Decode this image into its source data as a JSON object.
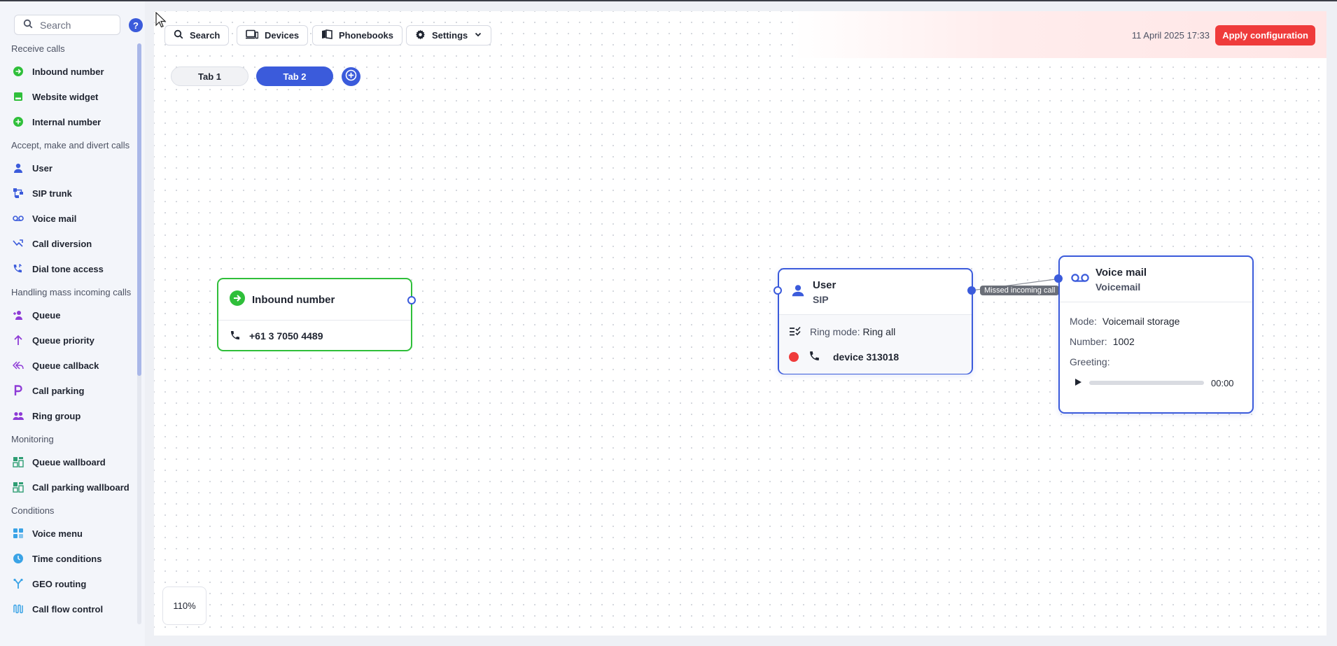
{
  "sidebar": {
    "search_placeholder": "Search",
    "help_label": "?",
    "sections": [
      {
        "title": "Receive calls",
        "items": [
          {
            "label": "Inbound number",
            "icon": "arrow-right-circle-icon",
            "color": "#2fbf3a"
          },
          {
            "label": "Website widget",
            "icon": "widget-icon",
            "color": "#2fbf3a"
          },
          {
            "label": "Internal number",
            "icon": "plus-circle-icon",
            "color": "#2fbf3a"
          }
        ]
      },
      {
        "title": "Accept, make and divert calls",
        "items": [
          {
            "label": "User",
            "icon": "user-icon",
            "color": "#3b5bdb"
          },
          {
            "label": "SIP trunk",
            "icon": "sip-trunk-icon",
            "color": "#3b5bdb"
          },
          {
            "label": "Voice mail",
            "icon": "voicemail-icon",
            "color": "#3b5bdb"
          },
          {
            "label": "Call diversion",
            "icon": "call-diversion-icon",
            "color": "#3b5bdb"
          },
          {
            "label": "Dial tone access",
            "icon": "phone-dial-icon",
            "color": "#3b5bdb"
          }
        ]
      },
      {
        "title": "Handling mass incoming calls",
        "items": [
          {
            "label": "Queue",
            "icon": "queue-icon",
            "color": "#8e3bd6"
          },
          {
            "label": "Queue priority",
            "icon": "arrow-up-icon",
            "color": "#8e3bd6"
          },
          {
            "label": "Queue callback",
            "icon": "reply-all-icon",
            "color": "#8e3bd6"
          },
          {
            "label": "Call parking",
            "icon": "parking-icon",
            "color": "#8e3bd6"
          },
          {
            "label": "Ring group",
            "icon": "group-icon",
            "color": "#8e3bd6"
          }
        ]
      },
      {
        "title": "Monitoring",
        "items": [
          {
            "label": "Queue wallboard",
            "icon": "wallboard-icon",
            "color": "#2f9e74"
          },
          {
            "label": "Call parking wallboard",
            "icon": "wallboard-icon",
            "color": "#2f9e74"
          }
        ]
      },
      {
        "title": "Conditions",
        "items": [
          {
            "label": "Voice menu",
            "icon": "voice-menu-icon",
            "color": "#3aa3e6"
          },
          {
            "label": "Time conditions",
            "icon": "clock-icon",
            "color": "#3aa3e6"
          },
          {
            "label": "GEO routing",
            "icon": "geo-routing-icon",
            "color": "#3aa3e6"
          },
          {
            "label": "Call flow control",
            "icon": "call-flow-icon",
            "color": "#3aa3e6"
          }
        ]
      }
    ]
  },
  "toolbar": {
    "search_label": "Search",
    "devices_label": "Devices",
    "phonebooks_label": "Phonebooks",
    "settings_label": "Settings",
    "datetime": "11 April 2025 17:33",
    "apply_label": "Apply configuration"
  },
  "tabs": [
    {
      "label": "Tab 1",
      "active": false
    },
    {
      "label": "Tab 2",
      "active": true
    }
  ],
  "canvas": {
    "zoom": "110%",
    "nodes": {
      "inbound": {
        "title": "Inbound number",
        "phone": "+61 3 7050 4489"
      },
      "user": {
        "title": "User",
        "subtitle": "SIP",
        "ring_mode_label": "Ring mode:",
        "ring_mode_value": "Ring all",
        "device": "device 313018",
        "device_status_color": "#ef3b3b"
      },
      "voicemail": {
        "title": "Voice mail",
        "subtitle": "Voicemail",
        "mode_label": "Mode:",
        "mode_value": "Voicemail storage",
        "number_label": "Number:",
        "number_value": "1002",
        "greeting_label": "Greeting:",
        "greeting_time": "00:00",
        "greeting_progress": 0
      }
    },
    "connection_label": "Missed incoming call"
  },
  "colors": {
    "accent": "#3b5bdb",
    "green": "#2fbf3a",
    "danger": "#ef3b3b"
  }
}
